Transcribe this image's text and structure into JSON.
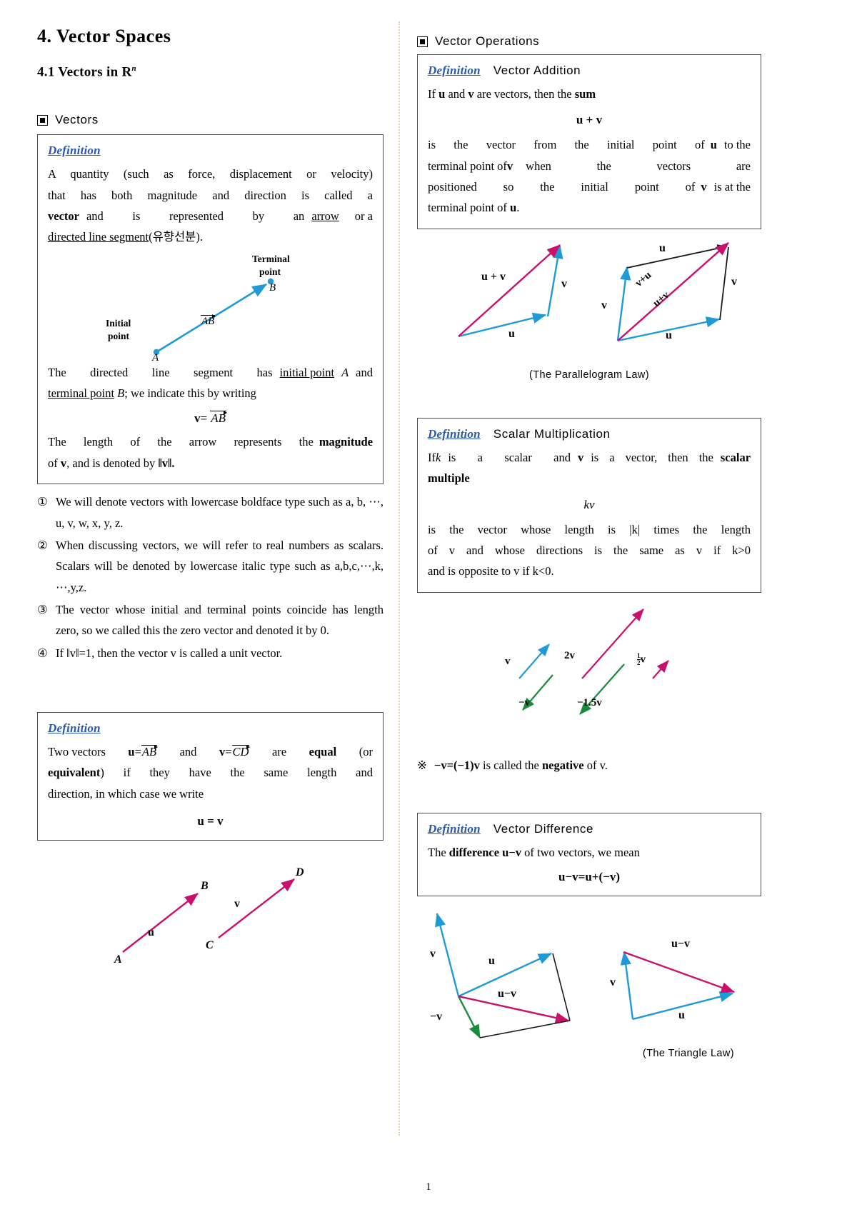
{
  "document": {
    "chapter_title": "4. Vector Spaces",
    "section_title_prefix": "4.1 Vectors in",
    "section_title_space": "R",
    "section_title_sup": "n",
    "page_number": "1"
  },
  "left": {
    "vectors_heading": "Vectors",
    "def_vectors": {
      "title": "Definition",
      "line1": "A quantity (such as force, displacement or velocity)",
      "line2": "that has both magnitude and direction is called a",
      "line3_a": "vector",
      "line3_b": "and is represented by an",
      "line3_c": "arrow",
      "line3_d": "or a",
      "line4_a": "directed line segment",
      "line4_b": "(유향선분).",
      "para2_a": "The directed line segment has",
      "para2_b": "initial point",
      "para2_c": "A",
      "para2_d": "and",
      "para2_e": "terminal point",
      "para2_f": "B",
      "para2_g": "; we indicate this by writing",
      "equation_v": "v",
      "equation_eq": "=",
      "equation_ab": "AB",
      "para3_a": "The length of the arrow represents the",
      "para3_b": "magnitude",
      "para3_c": "of",
      "para3_d": "v",
      "para3_e": ", and is denoted by",
      "para3_f": "‖v‖."
    },
    "figure_ab": {
      "terminal_label_line1": "Terminal",
      "terminal_label_line2": "point",
      "point_b": "B",
      "initial_label_line1": "Initial",
      "initial_label_line2": "point",
      "point_a": "A",
      "vector_label": "AB",
      "arrow_color": "#1f9ad6"
    },
    "notes": [
      {
        "num": "①",
        "text": "We will denote vectors with lowercase boldface type such as a, b, ⋯, u, v, w, x, y, z."
      },
      {
        "num": "②",
        "text": "When discussing vectors, we will refer to real numbers as scalars. Scalars will be denoted by lowercase italic type such as a,b,c,⋯,k, ⋯,y,z."
      },
      {
        "num": "③",
        "text": "The vector whose initial and terminal points coincide has length zero, so we called this the zero vector and denoted it by 0."
      },
      {
        "num": "④",
        "text": "If ‖v‖=1, then the vector v is called a unit vector."
      }
    ],
    "def_equal": {
      "title": "Definition",
      "line1_a": "Two vectors",
      "line1_b": "u",
      "line1_c": "=",
      "line1_d": "AB",
      "line1_e": "and",
      "line1_f": "v",
      "line1_g": "=",
      "line1_h": "CD",
      "line1_i": "are",
      "line1_j": "equal",
      "line1_k": "(or",
      "line2_a": "equivalent",
      "line2_b": ") if they have the same length and",
      "line3": "direction, in which case we write",
      "equation": "u = v"
    },
    "figure_equal": {
      "label_b": "B",
      "label_a": "A",
      "label_u": "u",
      "label_d": "D",
      "label_c": "C",
      "label_v": "v",
      "arrow_color": "#c9106c"
    }
  },
  "right": {
    "operations_heading": "Vector Operations",
    "def_addition": {
      "title": "Definition",
      "name": "Vector Addition",
      "line1_a": "If",
      "line1_b": "u",
      "line1_c": "and",
      "line1_d": "v",
      "line1_e": "are vectors, then the",
      "line1_f": "sum",
      "equation": "u + v",
      "body_line1": "is the vector from the initial point of",
      "body_u1": "u",
      "body_line2": "to the",
      "body_line3": "terminal point of",
      "body_v1": "v",
      "body_line4": "when the vectors are",
      "body_line5": "positioned so the initial point of",
      "body_v2": "v",
      "body_line6": "is at the",
      "body_line7": "terminal point of",
      "body_u2": "u",
      "body_line8": "."
    },
    "figure_addition": {
      "label_uv": "u + v",
      "label_v": "v",
      "label_u": "u",
      "caption": "(The Parallelogram Law)",
      "par_label_u_top": "u",
      "par_label_v_right": "v",
      "par_label_v_left": "v",
      "par_label_u_bottom": "u",
      "par_label_vpu": "v+u",
      "par_label_upv": "u+v",
      "blue": "#1f9ad6",
      "magenta": "#c9106c",
      "black": "#1a1a1a"
    },
    "def_scalar": {
      "title": "Definition",
      "name": "Scalar Multiplication",
      "line1_a": "If",
      "line1_k": "k",
      "line1_b": "is a scalar and",
      "line1_v": "v",
      "line1_c": "is a vector, then the",
      "line1_d": "scalar",
      "line2": "multiple",
      "equation": "kv",
      "body_a": "is the vector whose length is |k| times the length",
      "body_b": "of v and whose directions is the same as v if k>0",
      "body_c": "and is opposite to v if k<0."
    },
    "figure_scalar": {
      "label_v": "v",
      "label_2v": "2v",
      "label_half_v_num": "1",
      "label_half_v_den": "2",
      "label_half_v_vec": "v",
      "label_neg_v": "−v",
      "label_neg15v": "−1.5v",
      "blue": "#1f9ad6",
      "magenta": "#c9106c",
      "green": "#1a8a3c"
    },
    "negative_note": "※  −v=(−1)v is called the negative of v.",
    "negative_note_parts": {
      "mark": "※",
      "expr": "−v=(−1)v",
      "mid": "is called the",
      "bold": "negative",
      "end": "of v."
    },
    "def_difference": {
      "title": "Definition",
      "name": "Vector Difference",
      "line1_a": "The",
      "line1_b": "difference",
      "line1_c": "u−v",
      "line1_d": "of two vectors, we mean",
      "equation": "u−v=u+(−v)"
    },
    "figure_difference": {
      "label_v_left": "v",
      "label_u": "u",
      "label_umv_left": "u−v",
      "label_negv": "−v",
      "label_umv_right": "u−v",
      "label_v_right": "v",
      "label_u_right": "u",
      "caption": "(The Triangle Law)",
      "blue": "#1f9ad6",
      "magenta": "#c9106c",
      "green": "#1a8a3c",
      "black": "#1a1a1a"
    }
  }
}
